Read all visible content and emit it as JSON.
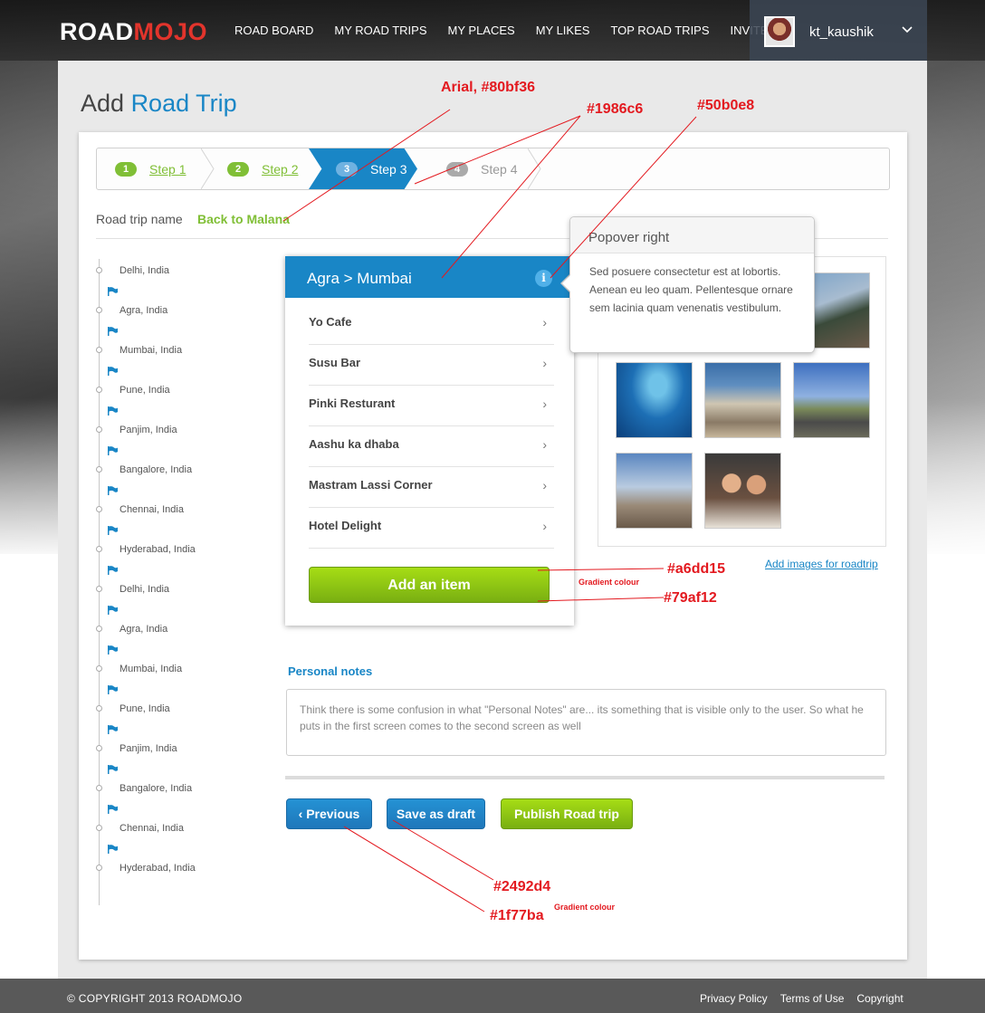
{
  "header": {
    "logo_road": "ROAD",
    "logo_mojo": "MOJO",
    "nav": [
      "ROAD BOARD",
      "MY ROAD TRIPS",
      "MY PLACES",
      "MY LIKES",
      "TOP ROAD TRIPS",
      "INVITE"
    ],
    "username": "kt_kaushik",
    "caret_icon": "chevron-down-icon"
  },
  "page": {
    "title_plain": "Add",
    "title_accent": "Road Trip"
  },
  "steps": [
    {
      "num": "1",
      "label": "Step 1",
      "state": "done"
    },
    {
      "num": "2",
      "label": "Step 2",
      "state": "done"
    },
    {
      "num": "3",
      "label": "Step 3",
      "state": "active"
    },
    {
      "num": "4",
      "label": "Step 4",
      "state": "todo"
    }
  ],
  "road_trip": {
    "name_label": "Road trip name",
    "name_value": "Back to Malana"
  },
  "timeline": [
    "Delhi, India",
    "Agra, India",
    "Mumbai, India",
    "Pune, India",
    "Panjim, India",
    "Bangalore, India",
    "Chennai, India",
    "Hyderabad, India",
    "Delhi, India",
    "Agra, India",
    "Mumbai, India",
    "Pune, India",
    "Panjim, India",
    "Bangalore, India",
    "Chennai, India",
    "Hyderabad, India"
  ],
  "panel": {
    "title": "Agra > Mumbai",
    "items": [
      "Yo Cafe",
      "Susu Bar",
      "Pinki Resturant",
      "Aashu ka dhaba",
      "Mastram Lassi Corner",
      "Hotel Delight"
    ],
    "add_button": "Add an item"
  },
  "popover": {
    "title": "Popover right",
    "body": "Sed posuere consectetur est at lobortis. Aenean eu leo quam. Pellentesque ornare sem lacinia quam venenatis vestibulum."
  },
  "images": {
    "add_link": "Add images for roadtrip"
  },
  "notes": {
    "label": "Personal notes",
    "text": "Think there is some confusion in what \"Personal Notes\" are... its something that is visible only to the user. So what he puts in the first screen comes to the second screen as well"
  },
  "buttons": {
    "previous": "‹ Previous",
    "save_draft": "Save as draft",
    "publish": "Publish Road trip"
  },
  "annotations": {
    "font_note": "Arial, #80bf36",
    "blue_note": "#1986c6",
    "info_note": "#50b0e8",
    "green_top": "#a6dd15",
    "green_bottom": "#79af12",
    "green_gradient": "Gradient colour",
    "blue_top": "#2492d4",
    "blue_bottom": "#1f77ba",
    "blue_gradient": "Gradient colour"
  },
  "colors": {
    "accent_blue": "#1986c6",
    "accent_green": "#80bf36",
    "info_blue": "#50b0e8",
    "annotation_red": "#e3191f"
  },
  "footer": {
    "copyright": "© COPYRIGHT 2013 ROADMOJO",
    "links": [
      "Privacy Policy",
      "Terms of Use",
      "Copyright"
    ]
  }
}
